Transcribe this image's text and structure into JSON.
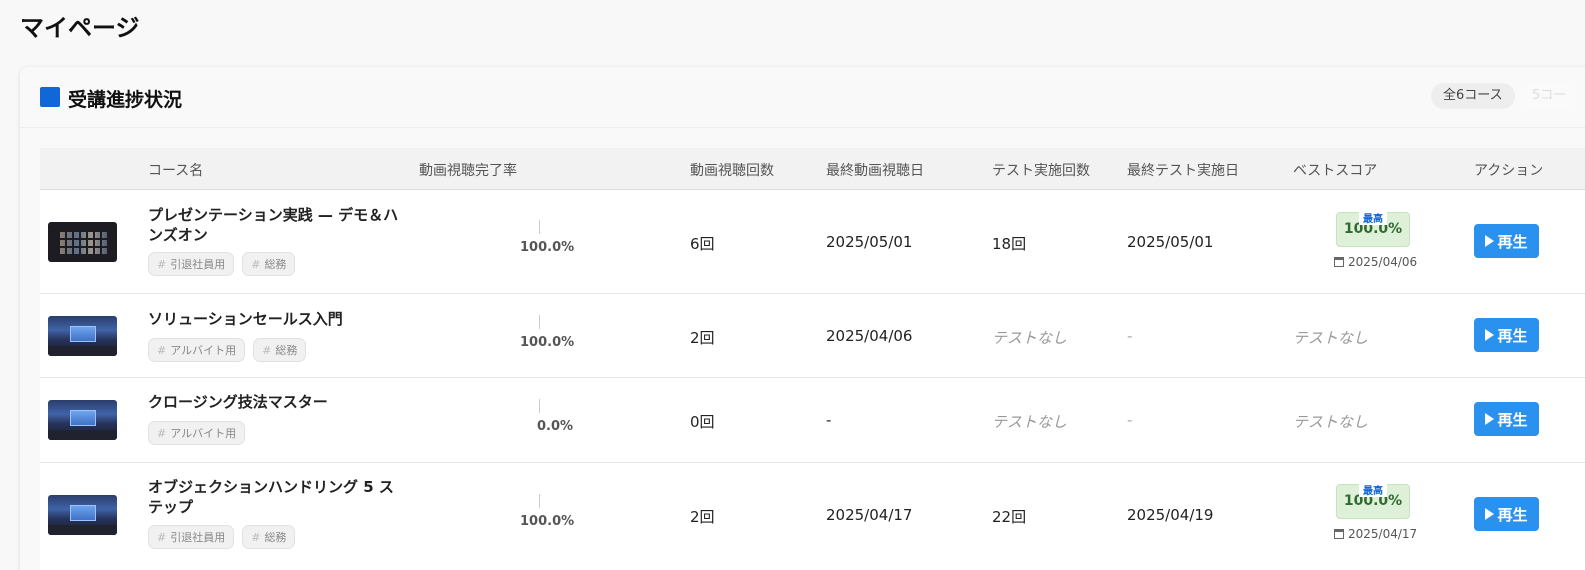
{
  "page_title": "マイページ",
  "card": {
    "title": "受講進捗状況",
    "total_pill": "全6コース",
    "faded_pill": "5コー"
  },
  "table": {
    "headers": {
      "course": "コース名",
      "progress": "動画視聴完了率",
      "views": "動画視聴回数",
      "last_view": "最終動画視聴日",
      "tests": "テスト実施回数",
      "last_test": "最終テスト実施日",
      "best": "ベストスコア",
      "action": "アクション"
    },
    "rows": [
      {
        "name": "プレゼンテーション実践 — デモ＆ハンズオン",
        "tags": [
          "引退社員用",
          "総務"
        ],
        "progress": "100.0%",
        "views": "6回",
        "last_view": "2025/05/01",
        "tests": "18回",
        "last_test": "2025/05/01",
        "best_label": "最高",
        "best_score": "100.0%",
        "best_date": "2025/04/06",
        "action": "再生"
      },
      {
        "name": "ソリューションセールス入門",
        "tags": [
          "アルバイト用",
          "総務"
        ],
        "progress": "100.0%",
        "views": "2回",
        "last_view": "2025/04/06",
        "tests": "テストなし",
        "last_test": "-",
        "best_none": "テストなし",
        "action": "再生"
      },
      {
        "name": "クロージング技法マスター",
        "tags": [
          "アルバイト用"
        ],
        "progress": "0.0%",
        "views": "0回",
        "last_view": "-",
        "tests": "テストなし",
        "last_test": "-",
        "best_none": "テストなし",
        "action": "再生"
      },
      {
        "name": "オブジェクションハンドリング 5 ステップ",
        "tags": [
          "引退社員用",
          "総務"
        ],
        "progress": "100.0%",
        "views": "2回",
        "last_view": "2025/04/17",
        "tests": "22回",
        "last_test": "2025/04/19",
        "best_label": "最高",
        "best_score": "100.0%",
        "best_date": "2025/04/17",
        "action": "再生"
      }
    ]
  },
  "colors": {
    "accent": "#1166d8",
    "play_button": "#2b91ef",
    "score_bg": "#dff0d8"
  }
}
